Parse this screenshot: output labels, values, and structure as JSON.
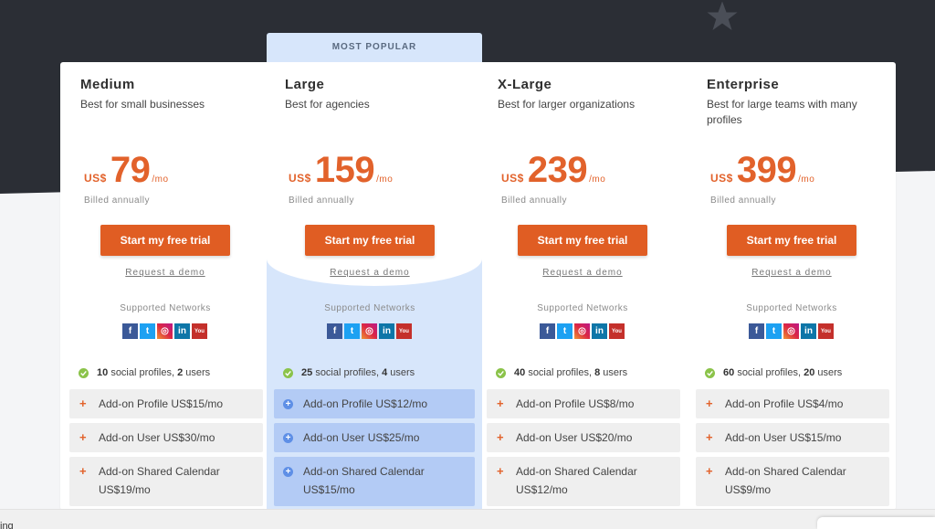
{
  "popular_label": "MOST POPULAR",
  "colors": {
    "accent": "#e05d23",
    "dark_bg": "#2b2e35",
    "popular_bg": "#d7e6fb",
    "addon_popular": "#b3cbf5",
    "check_green": "#8bc34a"
  },
  "common": {
    "billed": "Billed annually",
    "trial_button": "Start my free trial",
    "demo_link": "Request a demo",
    "networks_label": "Supported Networks",
    "network_icons": [
      "facebook-icon",
      "twitter-icon",
      "instagram-icon",
      "linkedin-icon",
      "youtube-icon"
    ],
    "network_glyphs": [
      "f",
      "t",
      "◎",
      "in",
      "You"
    ]
  },
  "plans": [
    {
      "name": "Medium",
      "desc": "Best for small businesses",
      "currency": "US$",
      "amount": "79",
      "period": "/mo",
      "profiles_count": "10",
      "profiles_text": "social profiles,",
      "users_count": "2",
      "users_text": "users",
      "addons": [
        "Add-on Profile US$15/mo",
        "Add-on User US$30/mo",
        "Add-on Shared Calendar US$19/mo"
      ]
    },
    {
      "name": "Large",
      "desc": "Best for agencies",
      "currency": "US$",
      "amount": "159",
      "period": "/mo",
      "profiles_count": "25",
      "profiles_text": "social profiles,",
      "users_count": "4",
      "users_text": "users",
      "addons": [
        "Add-on Profile US$12/mo",
        "Add-on User US$25/mo",
        "Add-on Shared Calendar US$15/mo"
      ]
    },
    {
      "name": "X-Large",
      "desc": "Best for larger organizations",
      "currency": "US$",
      "amount": "239",
      "period": "/mo",
      "profiles_count": "40",
      "profiles_text": "social profiles,",
      "users_count": "8",
      "users_text": "users",
      "addons": [
        "Add-on Profile US$8/mo",
        "Add-on User US$20/mo",
        "Add-on Shared Calendar US$12/mo"
      ]
    },
    {
      "name": "Enterprise",
      "desc": "Best for large teams with many profiles",
      "currency": "US$",
      "amount": "399",
      "period": "/mo",
      "profiles_count": "60",
      "profiles_text": "social profiles,",
      "users_count": "20",
      "users_text": "users",
      "addons": [
        "Add-on Profile US$4/mo",
        "Add-on User US$15/mo",
        "Add-on Shared Calendar US$9/mo"
      ]
    }
  ],
  "bottom_text": "ing"
}
